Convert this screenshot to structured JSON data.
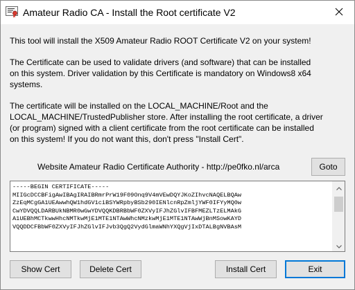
{
  "window": {
    "title": "Amateur Radio CA - Install the Root certificate V2"
  },
  "body": {
    "intro": "This tool will install the X509 Amateur Radio ROOT Certificate V2 on your system!",
    "validation": "The Certificate can be used to validate drivers (and software) that can be installed\non this system. Driver validation by this Certificate is mandatory on Windows8 x64\nsystems.",
    "store_info": "The certificate will be installed on the LOCAL_MACHINE/Root and the\nLOCAL_MACHINE/TrustedPublisher store. After installing the root certificate, a driver\n(or program) signed with a client certificate from the root certificate can be installed\non this system! If you do not want this, don't press \"Install Cert\"."
  },
  "website": {
    "label": "Website Amateur Radio Certificate Authority - http://pe0fko.nl/arca",
    "goto_label": "Goto"
  },
  "certificate": {
    "lines": [
      "-----BEGIN CERTIFICATE-----",
      "MIIGcDCCBFigAwIBAgIRAIBRmrPrW19F09Onq9V4mVEwDQYJKoZIhvcNAQELBQAw",
      "ZzEqMCgGA1UEAwwhQW1hdGV1ciBSYWRpbyBSb290IENlcnRpZmljYWF0IFYyMQ0w",
      "CwYDVQQLDARBUkNBMR0wGwYDVQQKDBRBbWF0ZXVyIFJhZGlvIFBFMEZLTzELMAkG",
      "A1UEBhMCTkwwHhcNMTkwMjE1MTE1NTAwWhcNMzkwMjE1MTE1NTAwWjBnMSowKAYD",
      "VQQDDCFBbWF0ZXVyIFJhZGlvIFJvb3QgQ2VydGlmaWNhYXQgVjIxDTALBgNVBAsM"
    ]
  },
  "actions": {
    "show_cert": "Show Cert",
    "delete_cert": "Delete Cert",
    "install_cert": "Install Cert",
    "exit": "Exit"
  },
  "icons": {
    "app": "certificate-icon",
    "close": "close-icon"
  }
}
